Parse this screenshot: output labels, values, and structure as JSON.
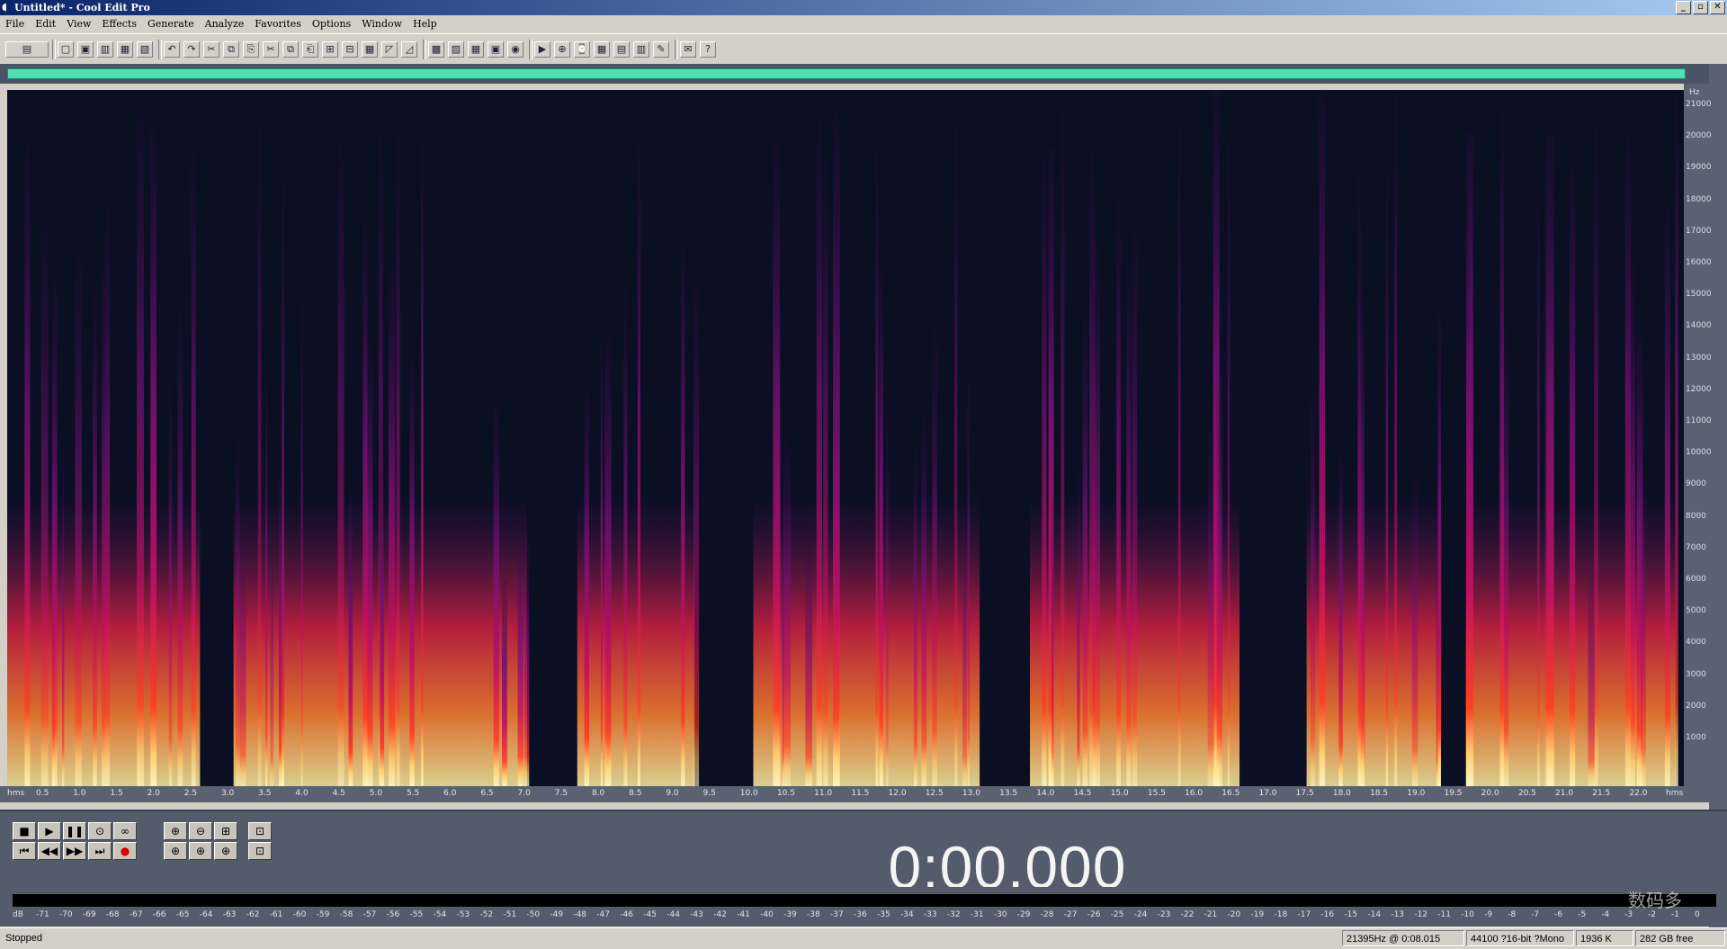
{
  "window": {
    "title": "Untitled* - Cool Edit Pro",
    "buttons": [
      "_",
      "▫",
      "✕"
    ]
  },
  "menu": [
    "File",
    "Edit",
    "View",
    "Effects",
    "Generate",
    "Analyze",
    "Favorites",
    "Options",
    "Window",
    "Help"
  ],
  "toolbar_icons": [
    "waveform-view-icon",
    "new-icon",
    "open-icon",
    "save-icon",
    "save-all-icon",
    "close-icon",
    "undo-icon",
    "redo-icon",
    "repeat-icon",
    "copy-new-icon",
    "paste-new-icon",
    "cut-icon",
    "copy-icon",
    "paste-icon",
    "mix-paste-icon",
    "trim-icon",
    "zero-icon",
    "envelope-icon",
    "fade-icon",
    "noise-icon",
    "amplify-icon",
    "settings-icon",
    "metronome-icon",
    "cd-icon",
    "play-icon",
    "zoom-icon",
    "time-icon",
    "grid-icon",
    "spectrum-icon",
    "levels-icon",
    "tools-icon",
    "about-icon",
    "help-icon"
  ],
  "freq_axis": {
    "unit": "Hz",
    "ticks": [
      "21000",
      "20000",
      "19000",
      "18000",
      "17000",
      "16000",
      "15000",
      "14000",
      "13000",
      "12000",
      "11000",
      "10000",
      "9000",
      "8000",
      "7000",
      "6000",
      "5000",
      "4000",
      "3000",
      "2000",
      "1000"
    ]
  },
  "time_axis": {
    "start_label": "hms",
    "end_label": "hms",
    "ticks": [
      "0.5",
      "1.0",
      "1.5",
      "2.0",
      "2.5",
      "3.0",
      "3.5",
      "4.0",
      "4.5",
      "5.0",
      "5.5",
      "6.0",
      "6.5",
      "7.0",
      "7.5",
      "8.0",
      "8.5",
      "9.0",
      "9.5",
      "10.0",
      "10.5",
      "11.0",
      "11.5",
      "12.0",
      "12.5",
      "13.0",
      "13.5",
      "14.0",
      "14.5",
      "15.0",
      "15.5",
      "16.0",
      "16.5",
      "17.0",
      "17.5",
      "18.0",
      "18.5",
      "19.0",
      "19.5",
      "20.0",
      "20.5",
      "21.0",
      "21.5",
      "22.0"
    ]
  },
  "transport": {
    "buttons": [
      "■",
      "▶",
      "❚❚",
      "⊙",
      "∞",
      "⏮",
      "◀◀",
      "▶▶",
      "⏭",
      "●"
    ],
    "zoom_buttons": [
      "⊕",
      "⊖",
      "⊞",
      "⊡",
      "⊕",
      "⊕",
      "⊕",
      "⊡"
    ]
  },
  "timecode": "0:00.000",
  "level_meter": {
    "ticks": [
      "dB",
      "-71",
      "-70",
      "-69",
      "-68",
      "-67",
      "-66",
      "-65",
      "-64",
      "-63",
      "-62",
      "-61",
      "-60",
      "-59",
      "-58",
      "-57",
      "-56",
      "-55",
      "-54",
      "-53",
      "-52",
      "-51",
      "-50",
      "-49",
      "-48",
      "-47",
      "-46",
      "-45",
      "-44",
      "-43",
      "-42",
      "-41",
      "-40",
      "-39",
      "-38",
      "-37",
      "-36",
      "-35",
      "-34",
      "-33",
      "-32",
      "-31",
      "-30",
      "-29",
      "-28",
      "-27",
      "-26",
      "-25",
      "-24",
      "-23",
      "-22",
      "-21",
      "-20",
      "-19",
      "-18",
      "-17",
      "-16",
      "-15",
      "-14",
      "-13",
      "-12",
      "-11",
      "-10",
      "-9",
      "-8",
      "-7",
      "-6",
      "-5",
      "-4",
      "-3",
      "-2",
      "-1",
      "0"
    ]
  },
  "status": {
    "state": "Stopped",
    "cursor": "21395Hz @   0:08.015",
    "format": "44100 ?16-bit ?Mono",
    "size": "1936 K",
    "free": "282 GB free"
  },
  "watermark": "数码多",
  "colors": {
    "spectro_bg": "#0b0f24",
    "overview": "#4ee0b0",
    "panel": "#545b6a"
  }
}
